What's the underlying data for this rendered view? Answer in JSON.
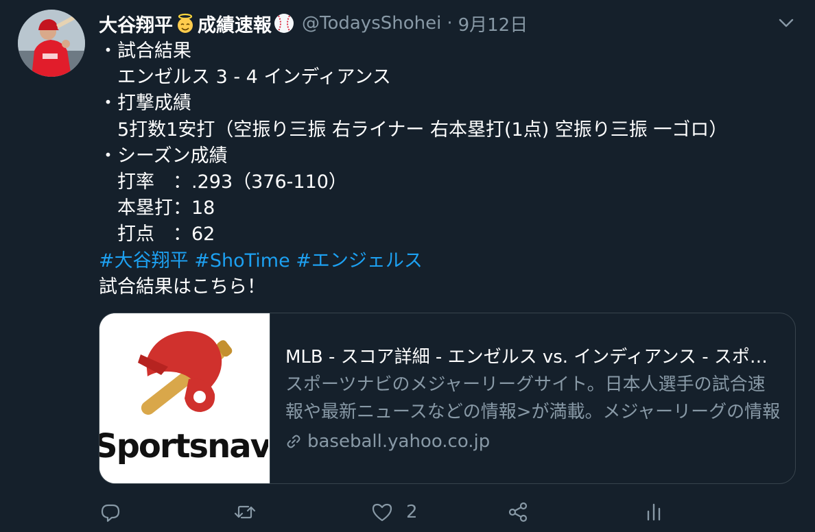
{
  "tweet": {
    "display_name_part1": "大谷翔平",
    "display_name_part2": "成績速報",
    "handle": "@TodaysShohei",
    "separator": "·",
    "date": "9月12日",
    "body_lines": [
      "・試合結果",
      "　エンゼルス 3 - 4 インディアンス",
      "・打撃成績",
      "　5打数1安打（空振り三振 右ライナー 右本塁打(1点) 空振り三振 一ゴロ）",
      "・シーズン成績",
      "　打率　：.293（376-110）",
      "　本塁打：18",
      "　打点　：62"
    ],
    "hashtags": [
      "#大谷翔平",
      "#ShoTime",
      "#エンジェルス"
    ],
    "closing_line": "試合結果はこちら！"
  },
  "card": {
    "title": "MLB - スコア詳細 - エンゼルス vs. インディアンス - スポーツナビ",
    "description": "スポーツナビのメジャーリーグサイト。日本人選手の試合速報や最新ニュースなどの情報>が満載。メジャーリーグの情報が満載です。",
    "domain": "baseball.yahoo.co.jp",
    "logo_text": "Sportsnavi"
  },
  "actions": {
    "reply_count": "",
    "retweet_count": "",
    "like_count": "2"
  },
  "colors": {
    "background": "#15202b",
    "text": "#ffffff",
    "muted": "#8899a6",
    "link": "#1da1f2",
    "border": "#38444d"
  },
  "icons": [
    "angel-emoji-icon",
    "baseball-emoji-icon",
    "chevron-down-icon",
    "link-icon",
    "reply-icon",
    "retweet-icon",
    "like-icon",
    "share-icon",
    "analytics-icon"
  ]
}
